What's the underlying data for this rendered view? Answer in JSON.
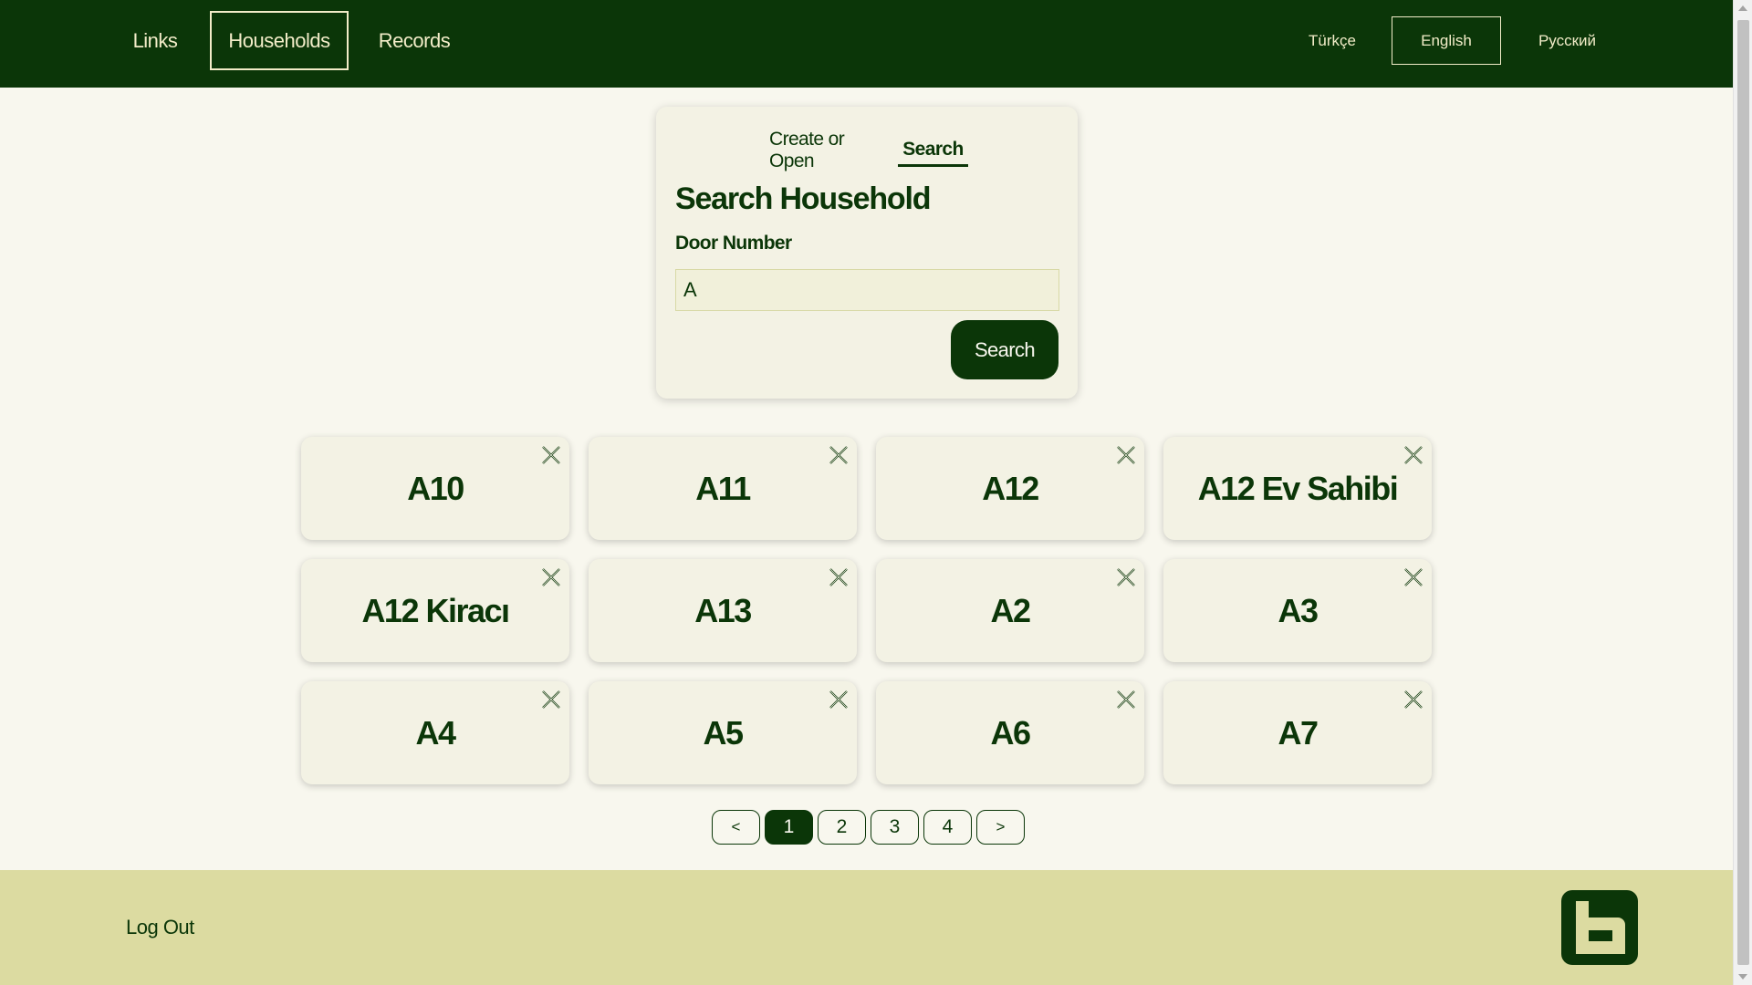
{
  "nav": {
    "items": [
      {
        "label": "Links",
        "active": false
      },
      {
        "label": "Households",
        "active": true
      },
      {
        "label": "Records",
        "active": false
      }
    ],
    "languages": [
      {
        "label": "Türkçe",
        "active": false
      },
      {
        "label": "English",
        "active": true
      },
      {
        "label": "Русский",
        "active": false
      }
    ]
  },
  "search_card": {
    "tabs": [
      {
        "label": "Create or Open",
        "active": false
      },
      {
        "label": "Search",
        "active": true
      }
    ],
    "title": "Search Household",
    "field_label": "Door Number",
    "field_value": "A",
    "button_label": "Search"
  },
  "households": [
    {
      "label": "A10"
    },
    {
      "label": "A11"
    },
    {
      "label": "A12"
    },
    {
      "label": "A12 Ev Sahibi"
    },
    {
      "label": "A12 Kiracı"
    },
    {
      "label": "A13"
    },
    {
      "label": "A2"
    },
    {
      "label": "A3"
    },
    {
      "label": "A4"
    },
    {
      "label": "A5"
    },
    {
      "label": "A6"
    },
    {
      "label": "A7"
    }
  ],
  "pagination": {
    "prev_label": "<",
    "next_label": ">",
    "pages": [
      "1",
      "2",
      "3",
      "4"
    ],
    "current": "1"
  },
  "footer": {
    "logout_label": "Log Out"
  },
  "colors": {
    "primary": "#0b3608",
    "background": "#f8f7ee",
    "card": "#f3f2e4",
    "footer": "#dcdba1",
    "nav_text": "#f2ecc8"
  }
}
